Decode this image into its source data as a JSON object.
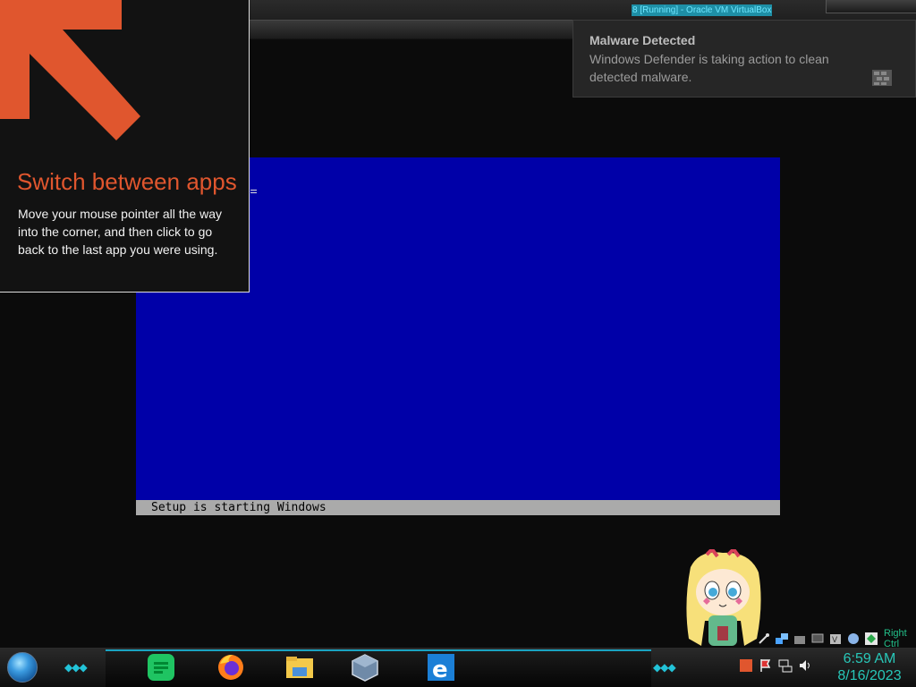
{
  "vbox": {
    "title": "8 [Running] - Oracle VM VirtualBox"
  },
  "vm": {
    "status_text": "Setup is starting Windows"
  },
  "tip": {
    "title": "Switch between apps",
    "body": "Move your mouse pointer all the way into the corner, and then click to go back to the last app you were using.",
    "accent_color": "#e0562e"
  },
  "toast": {
    "title": "Malware Detected",
    "body": "Windows Defender is taking action to clean detected malware."
  },
  "taskbar": {
    "apps": [
      "spotify-icon",
      "firefox-icon",
      "file-explorer-icon",
      "virtualbox-icon",
      "internet-explorer-icon"
    ],
    "right_ctrl": "Right Ctrl",
    "time": "6:59 AM",
    "date": "8/16/2023"
  }
}
